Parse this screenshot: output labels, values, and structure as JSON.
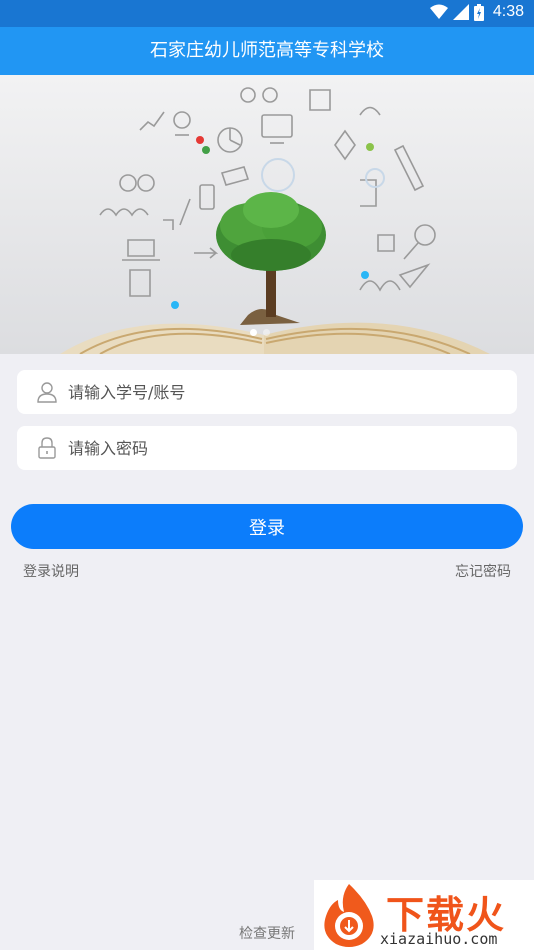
{
  "status_bar": {
    "time": "4:38"
  },
  "header": {
    "title": "石家庄幼儿师范高等专科学校"
  },
  "banner": {
    "page_count": 2,
    "active_page": 1
  },
  "form": {
    "username_placeholder": "请输入学号/账号",
    "password_placeholder": "请输入密码",
    "login_label": "登录",
    "help_label": "登录说明",
    "forgot_label": "忘记密码"
  },
  "footer": {
    "check_update_label": "检查更新"
  },
  "watermark": {
    "text_cn": "下载火",
    "url": "xiazaihuo.com"
  }
}
